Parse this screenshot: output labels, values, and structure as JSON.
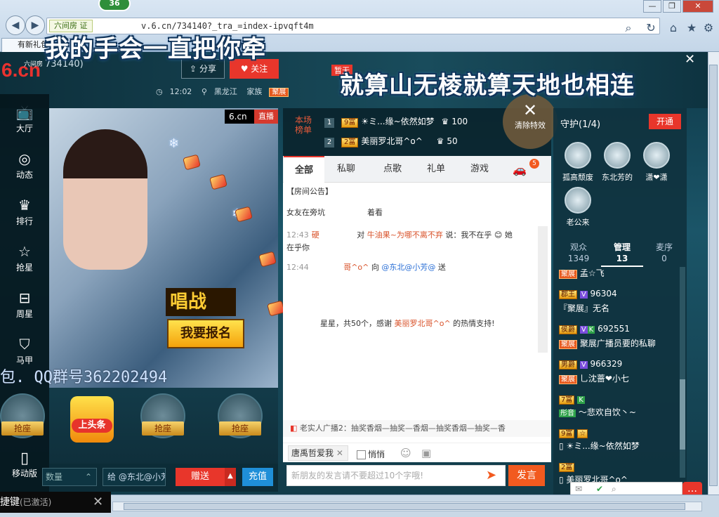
{
  "browser": {
    "badge": "36",
    "site_label": "六间房",
    "site_tag": "证",
    "url": "v.6.cn/734140?_tra_=index-ipvqft4m",
    "tab_title": "有新礼包",
    "icons": [
      "back-icon",
      "forward-icon",
      "search-icon",
      "refresh-icon",
      "home-icon",
      "star-icon",
      "gear-icon"
    ]
  },
  "lyrics": {
    "line1": "我的手会一直把你牵",
    "line2": "就算山无棱就算天地也相连"
  },
  "header": {
    "logo": "6.cn",
    "logo_sub": "六间房",
    "room_id": "734140)",
    "share": "分享",
    "follow": "关注",
    "time": "12:02",
    "location": "黑龙江",
    "family": "家族",
    "family_tag": "聚展",
    "zan_tag": "暂无"
  },
  "nav": {
    "items": [
      {
        "label": "大厅",
        "icon": "tv-icon"
      },
      {
        "label": "动态",
        "icon": "compass-icon"
      },
      {
        "label": "排行",
        "icon": "crown-icon"
      },
      {
        "label": "抢星",
        "icon": "star-icon"
      },
      {
        "label": "周星",
        "icon": "gift-icon"
      },
      {
        "label": "马甲",
        "icon": "shirt-icon"
      }
    ],
    "mobile": "移动版"
  },
  "video": {
    "brand": "6.cn",
    "live": "直播",
    "banner1": "唱战",
    "banner2": "我要报名",
    "qq": "包. QQ群号362202494"
  },
  "seats": {
    "grab": "抢座",
    "toutiao": "上头条"
  },
  "giftbar": {
    "qty_placeholder": "数量",
    "to": "给 @东北@小芳",
    "send": "赠送",
    "recharge": "充值"
  },
  "rank": {
    "title": "本场榜单",
    "rows": [
      {
        "num": "1",
        "level": "9富",
        "name": "☀ミ...缘~依然如梦",
        "score": "100"
      },
      {
        "num": "2",
        "level": "2富",
        "name": "美丽罗北哥^o^",
        "score": "50"
      }
    ],
    "clear": "清除特效"
  },
  "chat": {
    "tabs": [
      "全部",
      "私聊",
      "点歌",
      "礼单",
      "游戏"
    ],
    "car_badge": "5",
    "announce_head": "【房间公告】",
    "line1": "女友在旁坑",
    "line1b": "着看",
    "msg1": {
      "time": "12:43",
      "user": "硬",
      "to": "牛油果~为哪不离不弃",
      "text": "说：我不在乎",
      "text2": "她",
      "text3": "在乎你"
    },
    "msg2": {
      "time": "12:44",
      "user": "哥^o^",
      "action": "向",
      "to": "@东北@小芳@",
      "verb": "送"
    },
    "thanks": "星星，共50个，感谢",
    "thanks_user": "美丽罗北哥^o^",
    "thanks_tail": "的热情支持!",
    "broadcast": "老实人广播2：抽奖香烟—抽奖—香烟—抽奖香烟—抽奖—香",
    "at_user": "唐禹哲爱我",
    "whisper": "悄悄",
    "input_placeholder": "新朋友的发言请不要超过10个字哦!",
    "send": "发言"
  },
  "guard": {
    "title": "守护(1/4)",
    "open": "开通",
    "members": [
      "孤高颓废",
      "东北芳的",
      "潇❤潇",
      "老公来"
    ]
  },
  "tabs_right": [
    {
      "label": "观众",
      "count": "1349"
    },
    {
      "label": "管理",
      "count": "13"
    },
    {
      "label": "麦序",
      "count": "0"
    }
  ],
  "managers": [
    {
      "tags": [
        "聚展"
      ],
      "name": "孟☆飞"
    },
    {
      "tags": [
        "郡王",
        "V"
      ],
      "name": "96304"
    },
    {
      "tags": [],
      "name": "『聚展』无名"
    },
    {
      "tags": [
        "侯爵",
        "V",
        "K"
      ],
      "name": "692551"
    },
    {
      "tags": [
        "聚展"
      ],
      "name": "聚展广播员要的私聊"
    },
    {
      "tags": [
        "男爵",
        "V"
      ],
      "name": "966329"
    },
    {
      "tags": [
        "聚展"
      ],
      "name": "乚沈蔷❤小七"
    },
    {
      "tags": [
        "7富",
        "K"
      ],
      "name": ""
    },
    {
      "tags": [
        "彤音"
      ],
      "name": "〜悲欢自饮丶~"
    },
    {
      "tags": [
        "9富",
        "☆"
      ],
      "name": ""
    },
    {
      "tags": [],
      "name": "☀ミ...缘~依然如梦"
    },
    {
      "tags": [
        "2富"
      ],
      "name": ""
    },
    {
      "tags": [],
      "name": "美丽罗北哥^o^"
    }
  ],
  "bottom": {
    "hotkey": "捷键",
    "hotkey_state": "(已激活)"
  }
}
